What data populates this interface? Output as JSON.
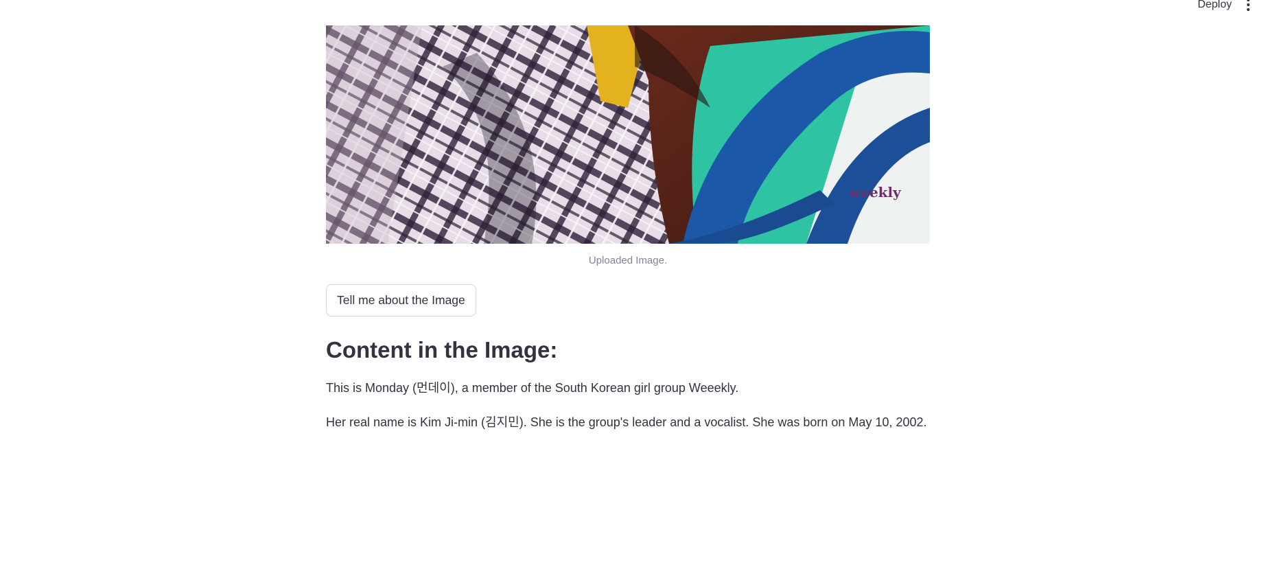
{
  "header": {
    "deploy_label": "Deploy",
    "menu_icon": "vertical-dots-icon"
  },
  "image": {
    "caption": "Uploaded Image.",
    "watermark": "weekly"
  },
  "action": {
    "button_label": "Tell me about the Image"
  },
  "result": {
    "heading": "Content in the Image:",
    "paragraphs": [
      "This is Monday (먼데이), a member of the South Korean girl group Weeekly.",
      "Her real name is Kim Ji-min (김지민). She is the group's leader and a vocalist. She was born on May 10, 2002."
    ]
  },
  "colors": {
    "text": "#31333f",
    "caption": "#808495",
    "border": "#d6d6d9"
  }
}
